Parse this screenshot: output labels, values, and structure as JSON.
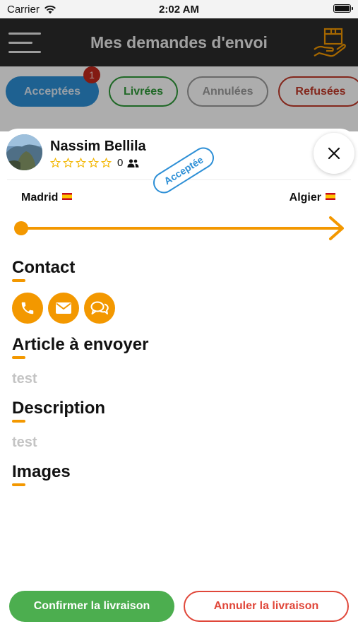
{
  "status_bar": {
    "carrier": "Carrier",
    "time": "2:02 AM"
  },
  "app_bar": {
    "title": "Mes demandes d'envoi"
  },
  "filters": {
    "accepted": {
      "label": "Acceptées",
      "badge": "1"
    },
    "delivered": {
      "label": "Livrées"
    },
    "cancelled": {
      "label": "Annulées"
    },
    "refused": {
      "label": "Refusées"
    }
  },
  "request": {
    "user_name": "Nassim Bellila",
    "rating_count": "0",
    "status": "Acceptée",
    "from_city": "Madrid",
    "to_city": "Algier",
    "sections": {
      "contact": "Contact",
      "article": "Article à envoyer",
      "article_value": "test",
      "description": "Description",
      "description_value": "test",
      "images": "Images"
    }
  },
  "actions": {
    "confirm": "Confirmer la livraison",
    "cancel": "Annuler la livraison"
  },
  "colors": {
    "accent_orange": "#f39800",
    "accepted_blue": "#2d8fd6",
    "delivered_green": "#2e9a38",
    "refused_red": "#c23a2a",
    "confirm_green": "#4cae4f"
  },
  "icons": [
    "menu-icon",
    "package-hand-icon",
    "close-icon",
    "star-icon",
    "people-icon",
    "phone-icon",
    "mail-icon",
    "chat-icon",
    "wifi-icon",
    "battery-icon",
    "flag-spain-icon"
  ]
}
